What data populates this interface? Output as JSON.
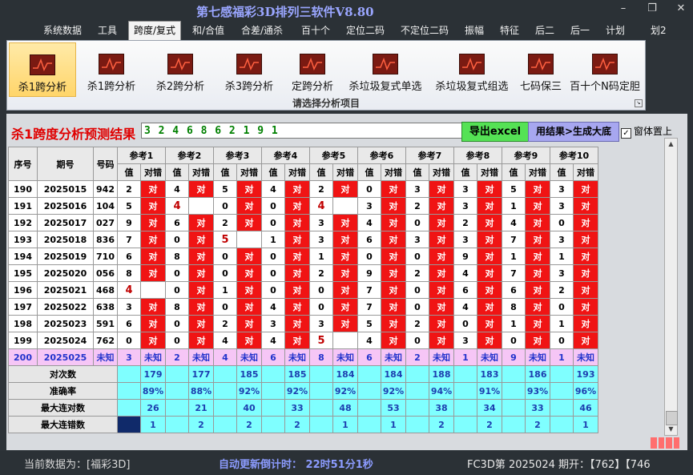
{
  "app_title": "第七感福彩3D排列三软件V8.80",
  "menu": [
    "系统数据",
    "工具",
    "跨度/复式",
    "和/合值",
    "合差/通杀",
    "百十个",
    "定位二码",
    "不定位二码",
    "振幅",
    "特征",
    "后二",
    "后一",
    "计划",
    "划2"
  ],
  "ribbon": {
    "buttons": [
      "杀1跨分析",
      "杀1跨分析",
      "杀2跨分析",
      "杀3跨分析",
      "定跨分析",
      "杀垃圾复式单选",
      "杀垃圾复式组选",
      "七码保三",
      "百十个N码定胆"
    ],
    "caption": "请选择分析项目"
  },
  "panel": {
    "title": "杀1跨度分析预测结果",
    "result": "3 2 4 6 8 6 2 1 9 1",
    "excel_label": "导出excel",
    "generate_label": "用结果>生成大底",
    "topmost_label": "窗体置上",
    "topmost_checked": "✓"
  },
  "table": {
    "head_seq": "序号",
    "head_period": "期号",
    "head_number": "号码",
    "refs": [
      "参考1",
      "参考2",
      "参考3",
      "参考4",
      "参考5",
      "参考6",
      "参考7",
      "参考8",
      "参考9",
      "参考10"
    ],
    "sub_value": "值",
    "sub_result": "对错",
    "hit_text": "对",
    "rows": [
      {
        "seq": "190",
        "period": "2025015",
        "number": "942",
        "cells": [
          [
            "2",
            "r"
          ],
          [
            "4",
            "r"
          ],
          [
            "5",
            "r"
          ],
          [
            "4",
            "r"
          ],
          [
            "2",
            "r"
          ],
          [
            "0",
            "r"
          ],
          [
            "3",
            "r"
          ],
          [
            "3",
            "r"
          ],
          [
            "5",
            "r"
          ],
          [
            "3",
            "r"
          ]
        ]
      },
      {
        "seq": "191",
        "period": "2025016",
        "number": "104",
        "cells": [
          [
            "5",
            "r"
          ],
          [
            "4",
            "e"
          ],
          [
            "0",
            "r"
          ],
          [
            "0",
            "r"
          ],
          [
            "4",
            "e"
          ],
          [
            "3",
            "r"
          ],
          [
            "2",
            "r"
          ],
          [
            "3",
            "r"
          ],
          [
            "1",
            "r"
          ],
          [
            "3",
            "r"
          ]
        ]
      },
      {
        "seq": "192",
        "period": "2025017",
        "number": "027",
        "cells": [
          [
            "9",
            "r"
          ],
          [
            "6",
            "r"
          ],
          [
            "2",
            "r"
          ],
          [
            "0",
            "r"
          ],
          [
            "3",
            "r"
          ],
          [
            "4",
            "r"
          ],
          [
            "0",
            "r"
          ],
          [
            "2",
            "r"
          ],
          [
            "4",
            "r"
          ],
          [
            "0",
            "r"
          ]
        ]
      },
      {
        "seq": "193",
        "period": "2025018",
        "number": "836",
        "cells": [
          [
            "7",
            "r"
          ],
          [
            "0",
            "r"
          ],
          [
            "5",
            "e"
          ],
          [
            "1",
            "r"
          ],
          [
            "3",
            "r"
          ],
          [
            "6",
            "r"
          ],
          [
            "3",
            "r"
          ],
          [
            "3",
            "r"
          ],
          [
            "7",
            "r"
          ],
          [
            "3",
            "r"
          ]
        ]
      },
      {
        "seq": "194",
        "period": "2025019",
        "number": "710",
        "cells": [
          [
            "6",
            "r"
          ],
          [
            "8",
            "r"
          ],
          [
            "0",
            "r"
          ],
          [
            "0",
            "r"
          ],
          [
            "1",
            "r"
          ],
          [
            "0",
            "r"
          ],
          [
            "0",
            "r"
          ],
          [
            "9",
            "r"
          ],
          [
            "1",
            "r"
          ],
          [
            "1",
            "r"
          ]
        ]
      },
      {
        "seq": "195",
        "period": "2025020",
        "number": "056",
        "cells": [
          [
            "8",
            "r"
          ],
          [
            "0",
            "r"
          ],
          [
            "0",
            "r"
          ],
          [
            "0",
            "r"
          ],
          [
            "2",
            "r"
          ],
          [
            "9",
            "r"
          ],
          [
            "2",
            "r"
          ],
          [
            "4",
            "r"
          ],
          [
            "7",
            "r"
          ],
          [
            "3",
            "r"
          ]
        ]
      },
      {
        "seq": "196",
        "period": "2025021",
        "number": "468",
        "cells": [
          [
            "4",
            "e"
          ],
          [
            "0",
            "r"
          ],
          [
            "1",
            "r"
          ],
          [
            "0",
            "r"
          ],
          [
            "0",
            "r"
          ],
          [
            "7",
            "r"
          ],
          [
            "0",
            "r"
          ],
          [
            "6",
            "r"
          ],
          [
            "6",
            "r"
          ],
          [
            "2",
            "r"
          ]
        ]
      },
      {
        "seq": "197",
        "period": "2025022",
        "number": "638",
        "cells": [
          [
            "3",
            "r"
          ],
          [
            "8",
            "r"
          ],
          [
            "0",
            "r"
          ],
          [
            "4",
            "r"
          ],
          [
            "0",
            "r"
          ],
          [
            "7",
            "r"
          ],
          [
            "0",
            "r"
          ],
          [
            "4",
            "r"
          ],
          [
            "8",
            "r"
          ],
          [
            "0",
            "r"
          ]
        ]
      },
      {
        "seq": "198",
        "period": "2025023",
        "number": "591",
        "cells": [
          [
            "6",
            "r"
          ],
          [
            "0",
            "r"
          ],
          [
            "2",
            "r"
          ],
          [
            "3",
            "r"
          ],
          [
            "3",
            "r"
          ],
          [
            "5",
            "r"
          ],
          [
            "2",
            "r"
          ],
          [
            "0",
            "r"
          ],
          [
            "1",
            "r"
          ],
          [
            "1",
            "r"
          ]
        ]
      },
      {
        "seq": "199",
        "period": "2025024",
        "number": "762",
        "cells": [
          [
            "0",
            "r"
          ],
          [
            "0",
            "r"
          ],
          [
            "4",
            "r"
          ],
          [
            "4",
            "r"
          ],
          [
            "5",
            "e"
          ],
          [
            "4",
            "r"
          ],
          [
            "0",
            "r"
          ],
          [
            "3",
            "r"
          ],
          [
            "0",
            "r"
          ],
          [
            "0",
            "r"
          ]
        ]
      }
    ],
    "current": {
      "seq": "200",
      "period": "2025025",
      "number": "未知",
      "unknown": "未知",
      "values": [
        "3",
        "2",
        "4",
        "6",
        "8",
        "6",
        "2",
        "1",
        "9",
        "1"
      ]
    },
    "stats": [
      {
        "label": "对次数",
        "values": [
          "179",
          "177",
          "185",
          "185",
          "184",
          "184",
          "188",
          "183",
          "186",
          "193"
        ]
      },
      {
        "label": "准确率",
        "values": [
          "89%",
          "88%",
          "92%",
          "92%",
          "92%",
          "92%",
          "94%",
          "91%",
          "93%",
          "96%"
        ]
      },
      {
        "label": "最大连对数",
        "values": [
          "26",
          "21",
          "40",
          "33",
          "48",
          "53",
          "38",
          "34",
          "33",
          "46"
        ]
      },
      {
        "label": "最大连错数",
        "values": [
          "1",
          "2",
          "2",
          "2",
          "1",
          "1",
          "2",
          "2",
          "2",
          "1"
        ]
      }
    ]
  },
  "status": {
    "data_source": "当前数据为：[福彩3D]",
    "countdown": "自动更新倒计时：  22时51分1秒",
    "draw_info": "FC3D第 2025024 期开：【762】【746"
  }
}
